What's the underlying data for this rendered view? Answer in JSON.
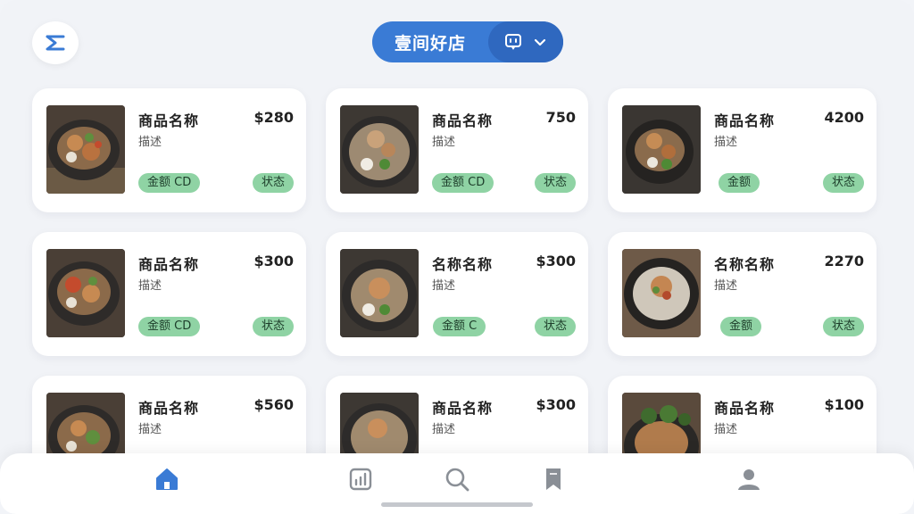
{
  "header": {
    "store_name": "壹间好店",
    "menu_icon": "menu-icon",
    "toggle_icon": "chat-icon",
    "dropdown_icon": "chevron-down-icon"
  },
  "items": [
    {
      "name": "商品名称",
      "price": "$280",
      "sub": "描述",
      "badge_left": "金额 CD",
      "badge_right": "状态"
    },
    {
      "name": "商品名称",
      "price": "750",
      "sub": "描述",
      "badge_left": "金额 CD",
      "badge_right": "状态"
    },
    {
      "name": "商品名称",
      "price": "4200",
      "sub": "描述",
      "badge_left": "金额",
      "badge_right": "状态"
    },
    {
      "name": "商品名称",
      "price": "$300",
      "sub": "描述",
      "badge_left": "金额 CD",
      "badge_right": "状态"
    },
    {
      "name": "名称名称",
      "price": "$300",
      "sub": "描述",
      "badge_left": "金额 C",
      "badge_right": "状态"
    },
    {
      "name": "名称名称",
      "price": "2270",
      "sub": "描述",
      "badge_left": "金额",
      "badge_right": "状态"
    },
    {
      "name": "商品名称",
      "price": "$560",
      "sub": "描述"
    },
    {
      "name": "商品名称",
      "price": "$300",
      "sub": "描述"
    },
    {
      "name": "商品名称",
      "price": "$100",
      "sub": "描述"
    }
  ],
  "nav": {
    "items": [
      {
        "icon": "home-icon",
        "active": true
      },
      {
        "icon": "chart-icon",
        "active": false
      },
      {
        "icon": "search-icon",
        "active": false
      },
      {
        "icon": "bookmark-icon",
        "active": false
      },
      {
        "icon": "profile-icon",
        "active": false
      }
    ]
  },
  "colors": {
    "accent": "#3a7bd5",
    "badge": "#8fd3a4",
    "nav_inactive": "#8a8f96"
  }
}
